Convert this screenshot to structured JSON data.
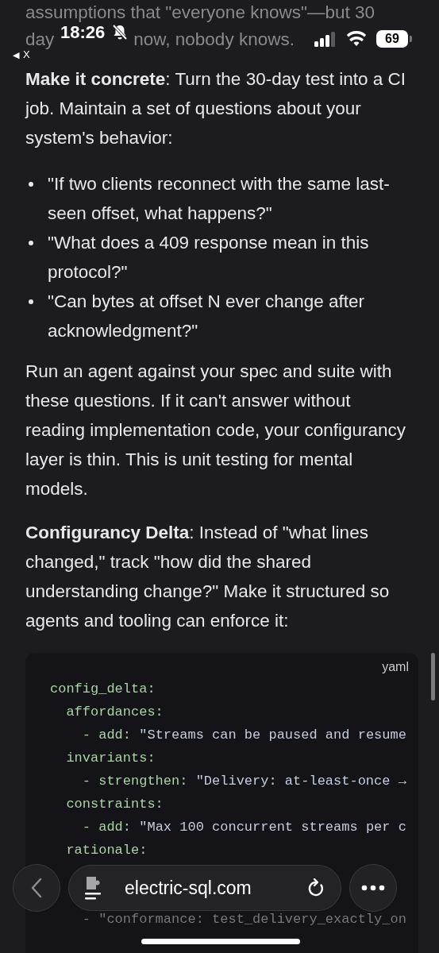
{
  "status_bar": {
    "time": "18:26",
    "back_arrow": "◀",
    "back_label": "X",
    "battery": "69"
  },
  "article": {
    "intro": {
      "line_1": "assumptions that \"everyone knows\"—but 30",
      "line_2_parts": [
        "day",
        "now, nobody knows."
      ]
    },
    "paragraph_1": "**Make it concrete**: Turn the 30-day test into a CI job. Maintain a set of questions about your system's behavior:",
    "bullets": [
      "\"If two clients reconnect with the same last-seen offset, what happens?\"",
      "\"What does a 409 response mean in this protocol?\"",
      "\"Can bytes at offset N ever change after acknowledgment?\""
    ],
    "paragraph_2": "Run an agent against your spec and suite with these questions. If it can't answer without reading implementation code, your configurancy layer is thin. This is unit testing for mental models.",
    "paragraph_3": "**Configurancy Delta**: Instead of \"what lines changed,\" track \"how did the shared understanding change?\" Make it structured so agents and tooling can enforce it:",
    "code_block": {
      "language": "yaml",
      "lines": [
        {
          "kind": "key",
          "key": "config_delta:"
        },
        {
          "kind": "key",
          "key": "  affordances:"
        },
        {
          "kind": "item",
          "key": "    - add:",
          "value": " \"Streams can be paused and resume"
        },
        {
          "kind": "key",
          "key": "  invariants:"
        },
        {
          "kind": "item",
          "key": "    - strengthen:",
          "value": " \"Delivery: at-least-once →"
        },
        {
          "kind": "key",
          "key": "  constraints:"
        },
        {
          "kind": "item",
          "key": "    - add:",
          "value": " \"Max 100 concurrent streams per c"
        },
        {
          "kind": "key",
          "key": "  rationale:"
        },
        {
          "kind": "spacer"
        },
        {
          "kind": "spacer"
        },
        {
          "kind": "dim",
          "key": "    - \"conformance: test_delivery_exactly_on"
        }
      ]
    }
  },
  "browser_toolbar": {
    "url": "electric-sql.com"
  }
}
